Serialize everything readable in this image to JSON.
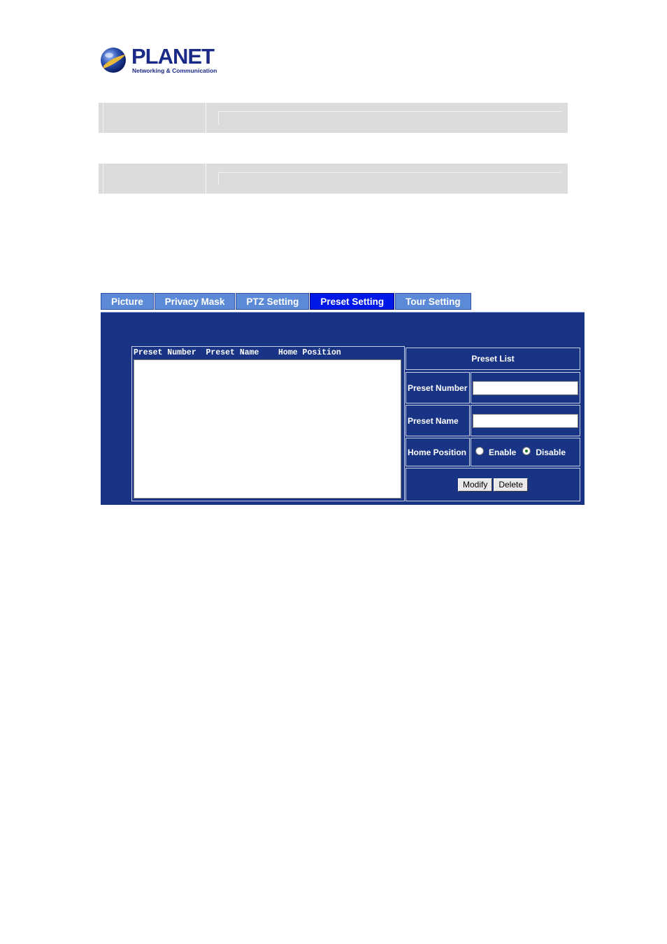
{
  "brand": {
    "name": "PLANET",
    "tagline": "Networking & Communication",
    "colors": {
      "navy": "#1a2a86",
      "orb_blue": "#2a4fb0",
      "orb_gold": "#e8b838"
    }
  },
  "tabs": [
    {
      "label": "Picture",
      "active": false
    },
    {
      "label": "Privacy Mask",
      "active": false
    },
    {
      "label": "PTZ Setting",
      "active": false
    },
    {
      "label": "Preset Setting",
      "active": true
    },
    {
      "label": "Tour Setting",
      "active": false
    }
  ],
  "preset_list": {
    "columns_header": "Preset Number  Preset Name    Home Position",
    "items": []
  },
  "form": {
    "title": "Preset List",
    "preset_number_label": "Preset Number",
    "preset_number_value": "",
    "preset_name_label": "Preset Name",
    "preset_name_value": "",
    "home_position_label": "Home Position",
    "enable_label": "Enable",
    "disable_label": "Disable",
    "home_position_selected": "Disable",
    "modify_label": "Modify",
    "delete_label": "Delete"
  },
  "colors": {
    "panel_bg": "#1a3485",
    "tab_bg": "#5d8ad6",
    "tab_active_bg": "#0018e8",
    "grey_row": "#dcdcdc"
  }
}
